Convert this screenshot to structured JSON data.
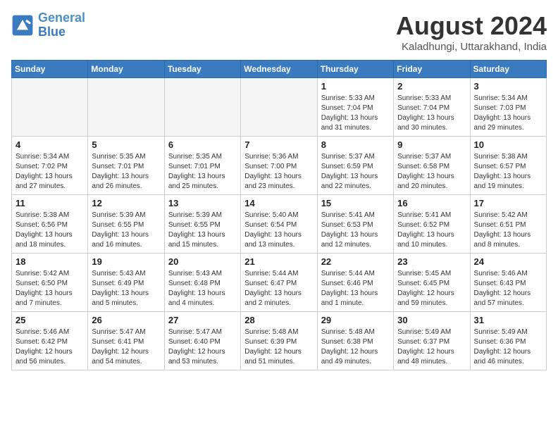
{
  "header": {
    "logo_line1": "General",
    "logo_line2": "Blue",
    "title": "August 2024",
    "subtitle": "Kaladhungi, Uttarakhand, India"
  },
  "weekdays": [
    "Sunday",
    "Monday",
    "Tuesday",
    "Wednesday",
    "Thursday",
    "Friday",
    "Saturday"
  ],
  "weeks": [
    [
      {
        "day": "",
        "info": ""
      },
      {
        "day": "",
        "info": ""
      },
      {
        "day": "",
        "info": ""
      },
      {
        "day": "",
        "info": ""
      },
      {
        "day": "1",
        "info": "Sunrise: 5:33 AM\nSunset: 7:04 PM\nDaylight: 13 hours\nand 31 minutes."
      },
      {
        "day": "2",
        "info": "Sunrise: 5:33 AM\nSunset: 7:04 PM\nDaylight: 13 hours\nand 30 minutes."
      },
      {
        "day": "3",
        "info": "Sunrise: 5:34 AM\nSunset: 7:03 PM\nDaylight: 13 hours\nand 29 minutes."
      }
    ],
    [
      {
        "day": "4",
        "info": "Sunrise: 5:34 AM\nSunset: 7:02 PM\nDaylight: 13 hours\nand 27 minutes."
      },
      {
        "day": "5",
        "info": "Sunrise: 5:35 AM\nSunset: 7:01 PM\nDaylight: 13 hours\nand 26 minutes."
      },
      {
        "day": "6",
        "info": "Sunrise: 5:35 AM\nSunset: 7:01 PM\nDaylight: 13 hours\nand 25 minutes."
      },
      {
        "day": "7",
        "info": "Sunrise: 5:36 AM\nSunset: 7:00 PM\nDaylight: 13 hours\nand 23 minutes."
      },
      {
        "day": "8",
        "info": "Sunrise: 5:37 AM\nSunset: 6:59 PM\nDaylight: 13 hours\nand 22 minutes."
      },
      {
        "day": "9",
        "info": "Sunrise: 5:37 AM\nSunset: 6:58 PM\nDaylight: 13 hours\nand 20 minutes."
      },
      {
        "day": "10",
        "info": "Sunrise: 5:38 AM\nSunset: 6:57 PM\nDaylight: 13 hours\nand 19 minutes."
      }
    ],
    [
      {
        "day": "11",
        "info": "Sunrise: 5:38 AM\nSunset: 6:56 PM\nDaylight: 13 hours\nand 18 minutes."
      },
      {
        "day": "12",
        "info": "Sunrise: 5:39 AM\nSunset: 6:55 PM\nDaylight: 13 hours\nand 16 minutes."
      },
      {
        "day": "13",
        "info": "Sunrise: 5:39 AM\nSunset: 6:55 PM\nDaylight: 13 hours\nand 15 minutes."
      },
      {
        "day": "14",
        "info": "Sunrise: 5:40 AM\nSunset: 6:54 PM\nDaylight: 13 hours\nand 13 minutes."
      },
      {
        "day": "15",
        "info": "Sunrise: 5:41 AM\nSunset: 6:53 PM\nDaylight: 13 hours\nand 12 minutes."
      },
      {
        "day": "16",
        "info": "Sunrise: 5:41 AM\nSunset: 6:52 PM\nDaylight: 13 hours\nand 10 minutes."
      },
      {
        "day": "17",
        "info": "Sunrise: 5:42 AM\nSunset: 6:51 PM\nDaylight: 13 hours\nand 8 minutes."
      }
    ],
    [
      {
        "day": "18",
        "info": "Sunrise: 5:42 AM\nSunset: 6:50 PM\nDaylight: 13 hours\nand 7 minutes."
      },
      {
        "day": "19",
        "info": "Sunrise: 5:43 AM\nSunset: 6:49 PM\nDaylight: 13 hours\nand 5 minutes."
      },
      {
        "day": "20",
        "info": "Sunrise: 5:43 AM\nSunset: 6:48 PM\nDaylight: 13 hours\nand 4 minutes."
      },
      {
        "day": "21",
        "info": "Sunrise: 5:44 AM\nSunset: 6:47 PM\nDaylight: 13 hours\nand 2 minutes."
      },
      {
        "day": "22",
        "info": "Sunrise: 5:44 AM\nSunset: 6:46 PM\nDaylight: 13 hours\nand 1 minute."
      },
      {
        "day": "23",
        "info": "Sunrise: 5:45 AM\nSunset: 6:45 PM\nDaylight: 12 hours\nand 59 minutes."
      },
      {
        "day": "24",
        "info": "Sunrise: 5:46 AM\nSunset: 6:43 PM\nDaylight: 12 hours\nand 57 minutes."
      }
    ],
    [
      {
        "day": "25",
        "info": "Sunrise: 5:46 AM\nSunset: 6:42 PM\nDaylight: 12 hours\nand 56 minutes."
      },
      {
        "day": "26",
        "info": "Sunrise: 5:47 AM\nSunset: 6:41 PM\nDaylight: 12 hours\nand 54 minutes."
      },
      {
        "day": "27",
        "info": "Sunrise: 5:47 AM\nSunset: 6:40 PM\nDaylight: 12 hours\nand 53 minutes."
      },
      {
        "day": "28",
        "info": "Sunrise: 5:48 AM\nSunset: 6:39 PM\nDaylight: 12 hours\nand 51 minutes."
      },
      {
        "day": "29",
        "info": "Sunrise: 5:48 AM\nSunset: 6:38 PM\nDaylight: 12 hours\nand 49 minutes."
      },
      {
        "day": "30",
        "info": "Sunrise: 5:49 AM\nSunset: 6:37 PM\nDaylight: 12 hours\nand 48 minutes."
      },
      {
        "day": "31",
        "info": "Sunrise: 5:49 AM\nSunset: 6:36 PM\nDaylight: 12 hours\nand 46 minutes."
      }
    ]
  ]
}
